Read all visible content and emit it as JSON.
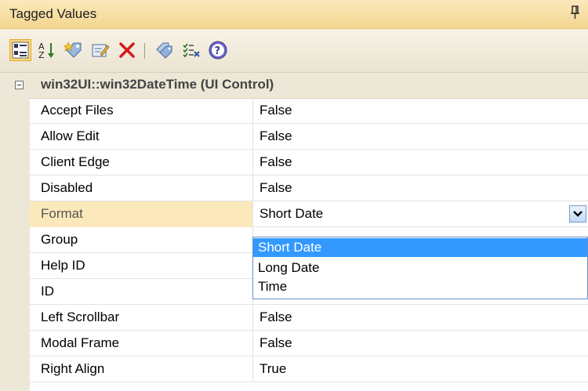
{
  "window": {
    "title": "Tagged Values"
  },
  "toolbar": {
    "buttons": [
      {
        "icon": "categorized-icon",
        "active": true
      },
      {
        "icon": "sort-alphabetical-icon"
      },
      {
        "icon": "new-tag-icon"
      },
      {
        "icon": "edit-tag-icon"
      },
      {
        "icon": "delete-icon"
      },
      {
        "icon": "tags-icon"
      },
      {
        "icon": "list-options-icon"
      },
      {
        "icon": "help-icon"
      }
    ]
  },
  "grid": {
    "group_title": "win32UI::win32DateTime (UI Control)",
    "rows": [
      {
        "name": "Accept Files",
        "value": "False"
      },
      {
        "name": "Allow Edit",
        "value": "False"
      },
      {
        "name": "Client Edge",
        "value": "False"
      },
      {
        "name": "Disabled",
        "value": "False"
      },
      {
        "name": "Format",
        "value": "Short Date"
      },
      {
        "name": "Group",
        "value": ""
      },
      {
        "name": "Help ID",
        "value": ""
      },
      {
        "name": "ID",
        "value": ""
      },
      {
        "name": "Left Scrollbar",
        "value": "False"
      },
      {
        "name": "Modal Frame",
        "value": "False"
      },
      {
        "name": "Right Align",
        "value": "True"
      }
    ],
    "selected_row": "Format"
  },
  "dropdown": {
    "options": [
      "Short Date",
      "Long Date",
      "Time"
    ],
    "highlighted": "Short Date"
  },
  "colors": {
    "title_bar": "#f3d58f",
    "selection": "#fbe9bb",
    "dropdown_highlight": "#3399ff"
  }
}
